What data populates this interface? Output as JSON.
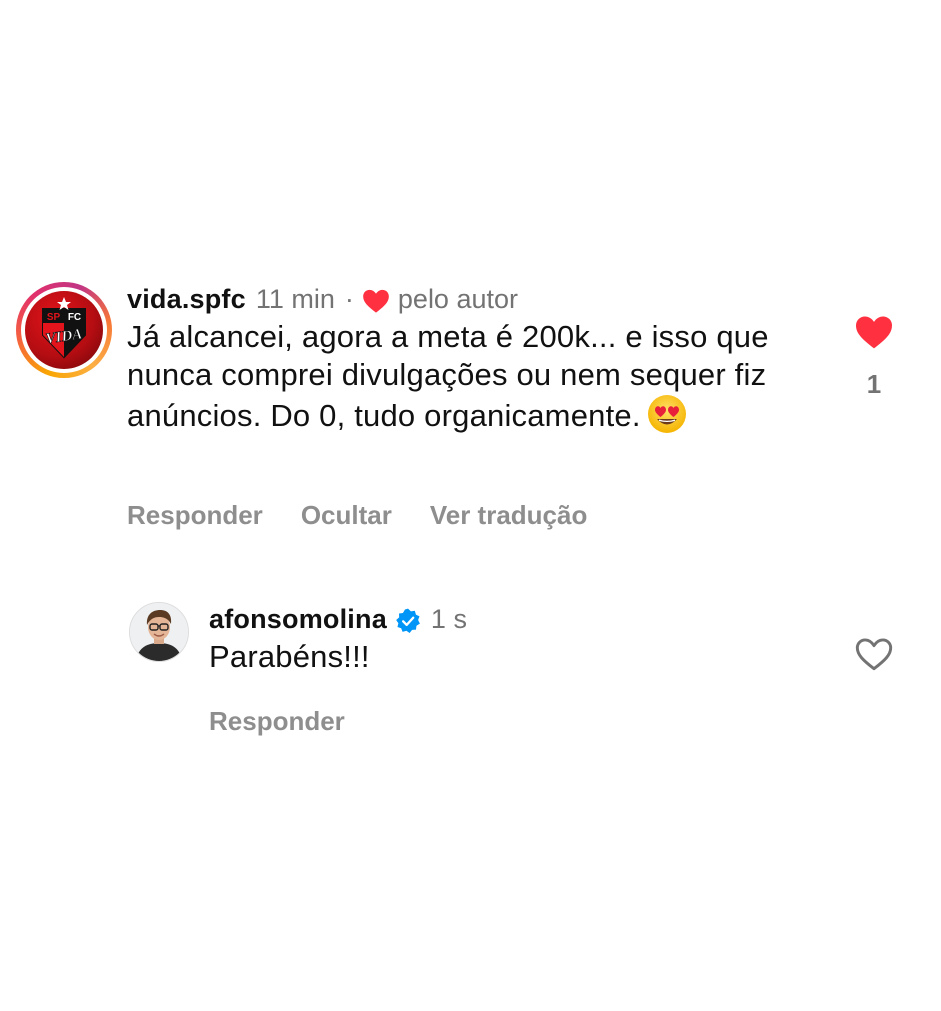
{
  "comments": [
    {
      "username": "vida.spfc",
      "time": "11 min",
      "separator": "·",
      "liked_by_author_label": "pelo autor",
      "text": "Já alcancei, agora a meta é 200k... e isso que nunca comprei divulgações ou nem sequer fiz anúncios. Do 0, tudo organicamente.",
      "emoji": "smiling-face-with-heart-eyes",
      "actions": [
        "Responder",
        "Ocultar",
        "Ver tradução"
      ],
      "liked": true,
      "like_count": "1",
      "avatar": {
        "icon": "spfc-vida-logo-icon",
        "logo_text_top_left": "SP",
        "logo_text_top_right": "FC",
        "logo_text_bottom": "VIDA"
      }
    },
    {
      "username": "afonsomolina",
      "verified": true,
      "time": "1 s",
      "text": "Parabéns!!!",
      "actions": [
        "Responder"
      ],
      "liked": false,
      "avatar": {
        "icon": "profile-photo-avatar"
      }
    }
  ],
  "colors": {
    "like_red": "#ff3040",
    "verified_blue": "#0095f6",
    "muted_gray": "#737373",
    "action_gray": "#8e8e8e"
  }
}
